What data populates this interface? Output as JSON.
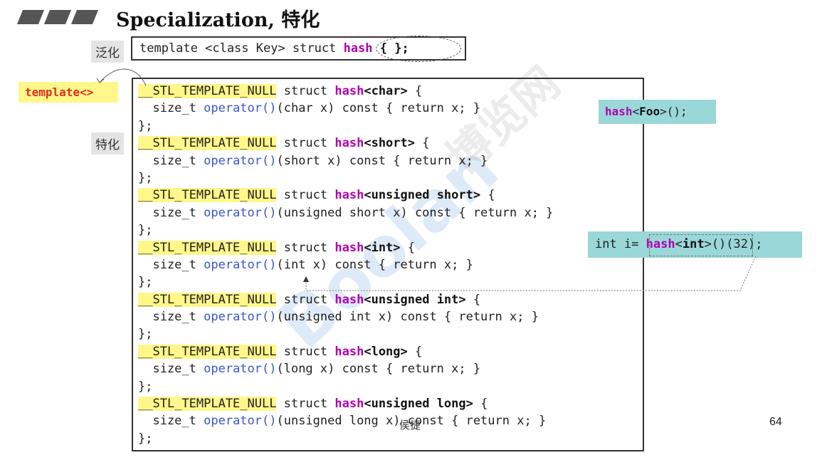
{
  "title": "Specialization, 特化",
  "tags": {
    "generic": "泛化",
    "specialization": "特化"
  },
  "generic_template": {
    "prefix": "template <class Key> struct ",
    "name": "hash",
    "suffix": " { };"
  },
  "template_marker": "template<>",
  "macro": "__STL_TEMPLATE_NULL",
  "keyword_struct": "struct",
  "keyword_hash": "hash",
  "operator": "operator()",
  "body_prefix": "  size_t ",
  "closing": "};",
  "specializations": [
    {
      "type": "<char>",
      "params": "(char x) const { return x; }"
    },
    {
      "type": "<short>",
      "params": "(short x) const { return x; }"
    },
    {
      "type": "<unsigned short>",
      "params": "(unsigned short x) const { return x; }"
    },
    {
      "type": "<int>",
      "params": "(int x) const { return x; }"
    },
    {
      "type": "<unsigned int>",
      "params": "(unsigned int x) const { return x; }"
    },
    {
      "type": "<long>",
      "params": "(long x) const { return x; }"
    },
    {
      "type": "<unsigned long>",
      "params": "(unsigned long x) const { return x; }"
    }
  ],
  "example_foo": {
    "name": "hash",
    "open": "<",
    "type": "Foo",
    "close": ">();"
  },
  "example_int": {
    "prefix": "int i= ",
    "name": "hash",
    "open": "<",
    "type": "int",
    "close": ">()",
    "suffix": "(32);"
  },
  "author": "侯捷",
  "page_number": "64",
  "watermark": {
    "main": "Boolan",
    "cn": "博览网"
  },
  "colors": {
    "highlight": "#fff78a",
    "keyword": "#b000b0",
    "operator": "#3a56c8",
    "callout": "#9ad7d9",
    "template_marker": "#e0301e"
  }
}
